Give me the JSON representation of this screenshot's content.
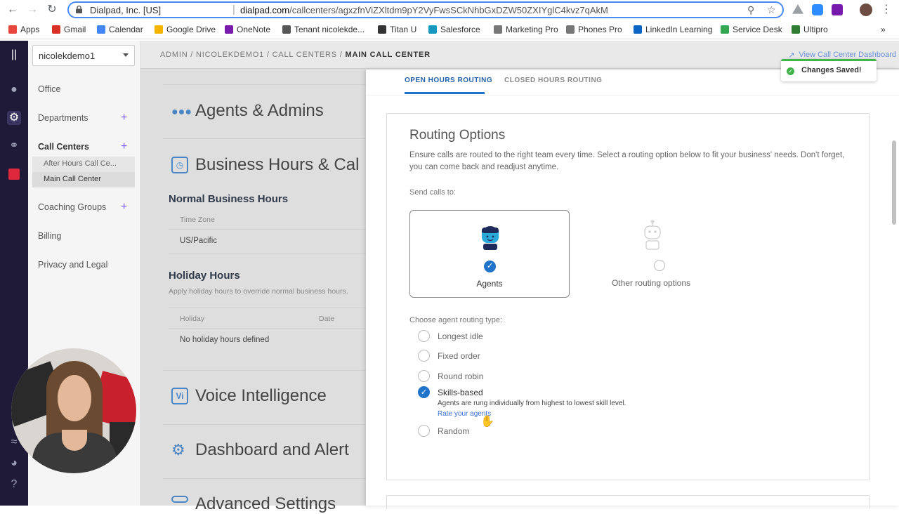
{
  "browser": {
    "site_name": "Dialpad, Inc. [US]",
    "url_domain": "dialpad.com",
    "url_path": "/callcenters/agxzfnViZXltdm9pY2VyFwsSCkNhbGxDZW50ZXIYglC4kvz7qAkM"
  },
  "bookmarks": [
    {
      "label": "Apps",
      "icon": "apps-grid-icon",
      "color": "#e8453c"
    },
    {
      "label": "Gmail",
      "icon": "gmail-icon",
      "color": "#d93025"
    },
    {
      "label": "Calendar",
      "icon": "google-icon",
      "color": "#4285f4"
    },
    {
      "label": "Google Drive",
      "icon": "drive-icon",
      "color": "#f4b400"
    },
    {
      "label": "OneNote",
      "icon": "onenote-icon",
      "color": "#7719aa"
    },
    {
      "label": "Tenant nicolekde...",
      "icon": "robot-icon",
      "color": "#555555"
    },
    {
      "label": "Titan U",
      "icon": "titan-icon",
      "color": "#333333"
    },
    {
      "label": "Salesforce",
      "icon": "salesforce-cloud-icon",
      "color": "#1798c1"
    },
    {
      "label": "Marketing Pro",
      "icon": "folder-icon",
      "color": "#777777"
    },
    {
      "label": "Phones Pro",
      "icon": "folder-icon",
      "color": "#777777"
    },
    {
      "label": "LinkedIn Learning",
      "icon": "linkedin-icon",
      "color": "#0a66c2"
    },
    {
      "label": "Service Desk",
      "icon": "service-desk-icon",
      "color": "#34a853"
    },
    {
      "label": "Ultipro",
      "icon": "ultipro-icon",
      "color": "#2e7d32"
    }
  ],
  "sidebar": {
    "company_select": "nicolekdemo1",
    "items": [
      {
        "label": "Office",
        "has_add": false
      },
      {
        "label": "Departments",
        "has_add": true
      },
      {
        "label": "Call Centers",
        "has_add": true
      },
      {
        "label": "Coaching Groups",
        "has_add": true
      },
      {
        "label": "Billing",
        "has_add": false
      },
      {
        "label": "Privacy and Legal",
        "has_add": false
      }
    ],
    "call_centers": [
      "After Hours Call Ce...",
      "Main Call Center"
    ]
  },
  "header": {
    "breadcrumb_prefix": "ADMIN / NICOLEKDEMO1 / CALL CENTERS / ",
    "breadcrumb_current": "MAIN CALL CENTER",
    "dashboard_link": "View Call Center Dashboard"
  },
  "background": {
    "agents_title": "Agents & Admins",
    "hours_title": "Business Hours & Cal",
    "normal_hours_title": "Normal Business Hours",
    "time_zone_label": "Time Zone",
    "time_zone_value": "US/Pacific",
    "holiday_title": "Holiday Hours",
    "holiday_desc": "Apply holiday hours to override normal business hours.",
    "holiday_col": "Holiday",
    "date_col": "Date",
    "holiday_empty": "No holiday hours defined",
    "voice_title": "Voice Intelligence",
    "voice_icon_text": "Vi",
    "dashboard_title": "Dashboard and Alert",
    "advanced_title": "Advanced Settings"
  },
  "panel": {
    "tabs": [
      "OPEN HOURS ROUTING",
      "CLOSED HOURS ROUTING"
    ],
    "active_tab": 0,
    "card_title": "Routing Options",
    "card_desc": "Ensure calls are routed to the right team every time. Select a routing option below to fit your business' needs. Don't forget, you can come back and readjust anytime.",
    "send_calls_label": "Send calls to:",
    "options": [
      {
        "label": "Agents",
        "selected": true
      },
      {
        "label": "Other routing options",
        "selected": false
      }
    ],
    "agent_routing_label": "Choose agent routing type:",
    "routing_types": [
      {
        "label": "Longest idle",
        "selected": false
      },
      {
        "label": "Fixed order",
        "selected": false
      },
      {
        "label": "Round robin",
        "selected": false
      },
      {
        "label": "Skills-based",
        "selected": true
      },
      {
        "label": "Random",
        "selected": false
      }
    ],
    "skills_help": "Agents are rung individually from highest to lowest skill level.",
    "rate_link": "Rate your agents"
  },
  "toast": {
    "message": "Changes Saved!"
  },
  "colors": {
    "accent": "#1f73c9",
    "success": "#3fb54a",
    "rail": "#1e1a38"
  }
}
